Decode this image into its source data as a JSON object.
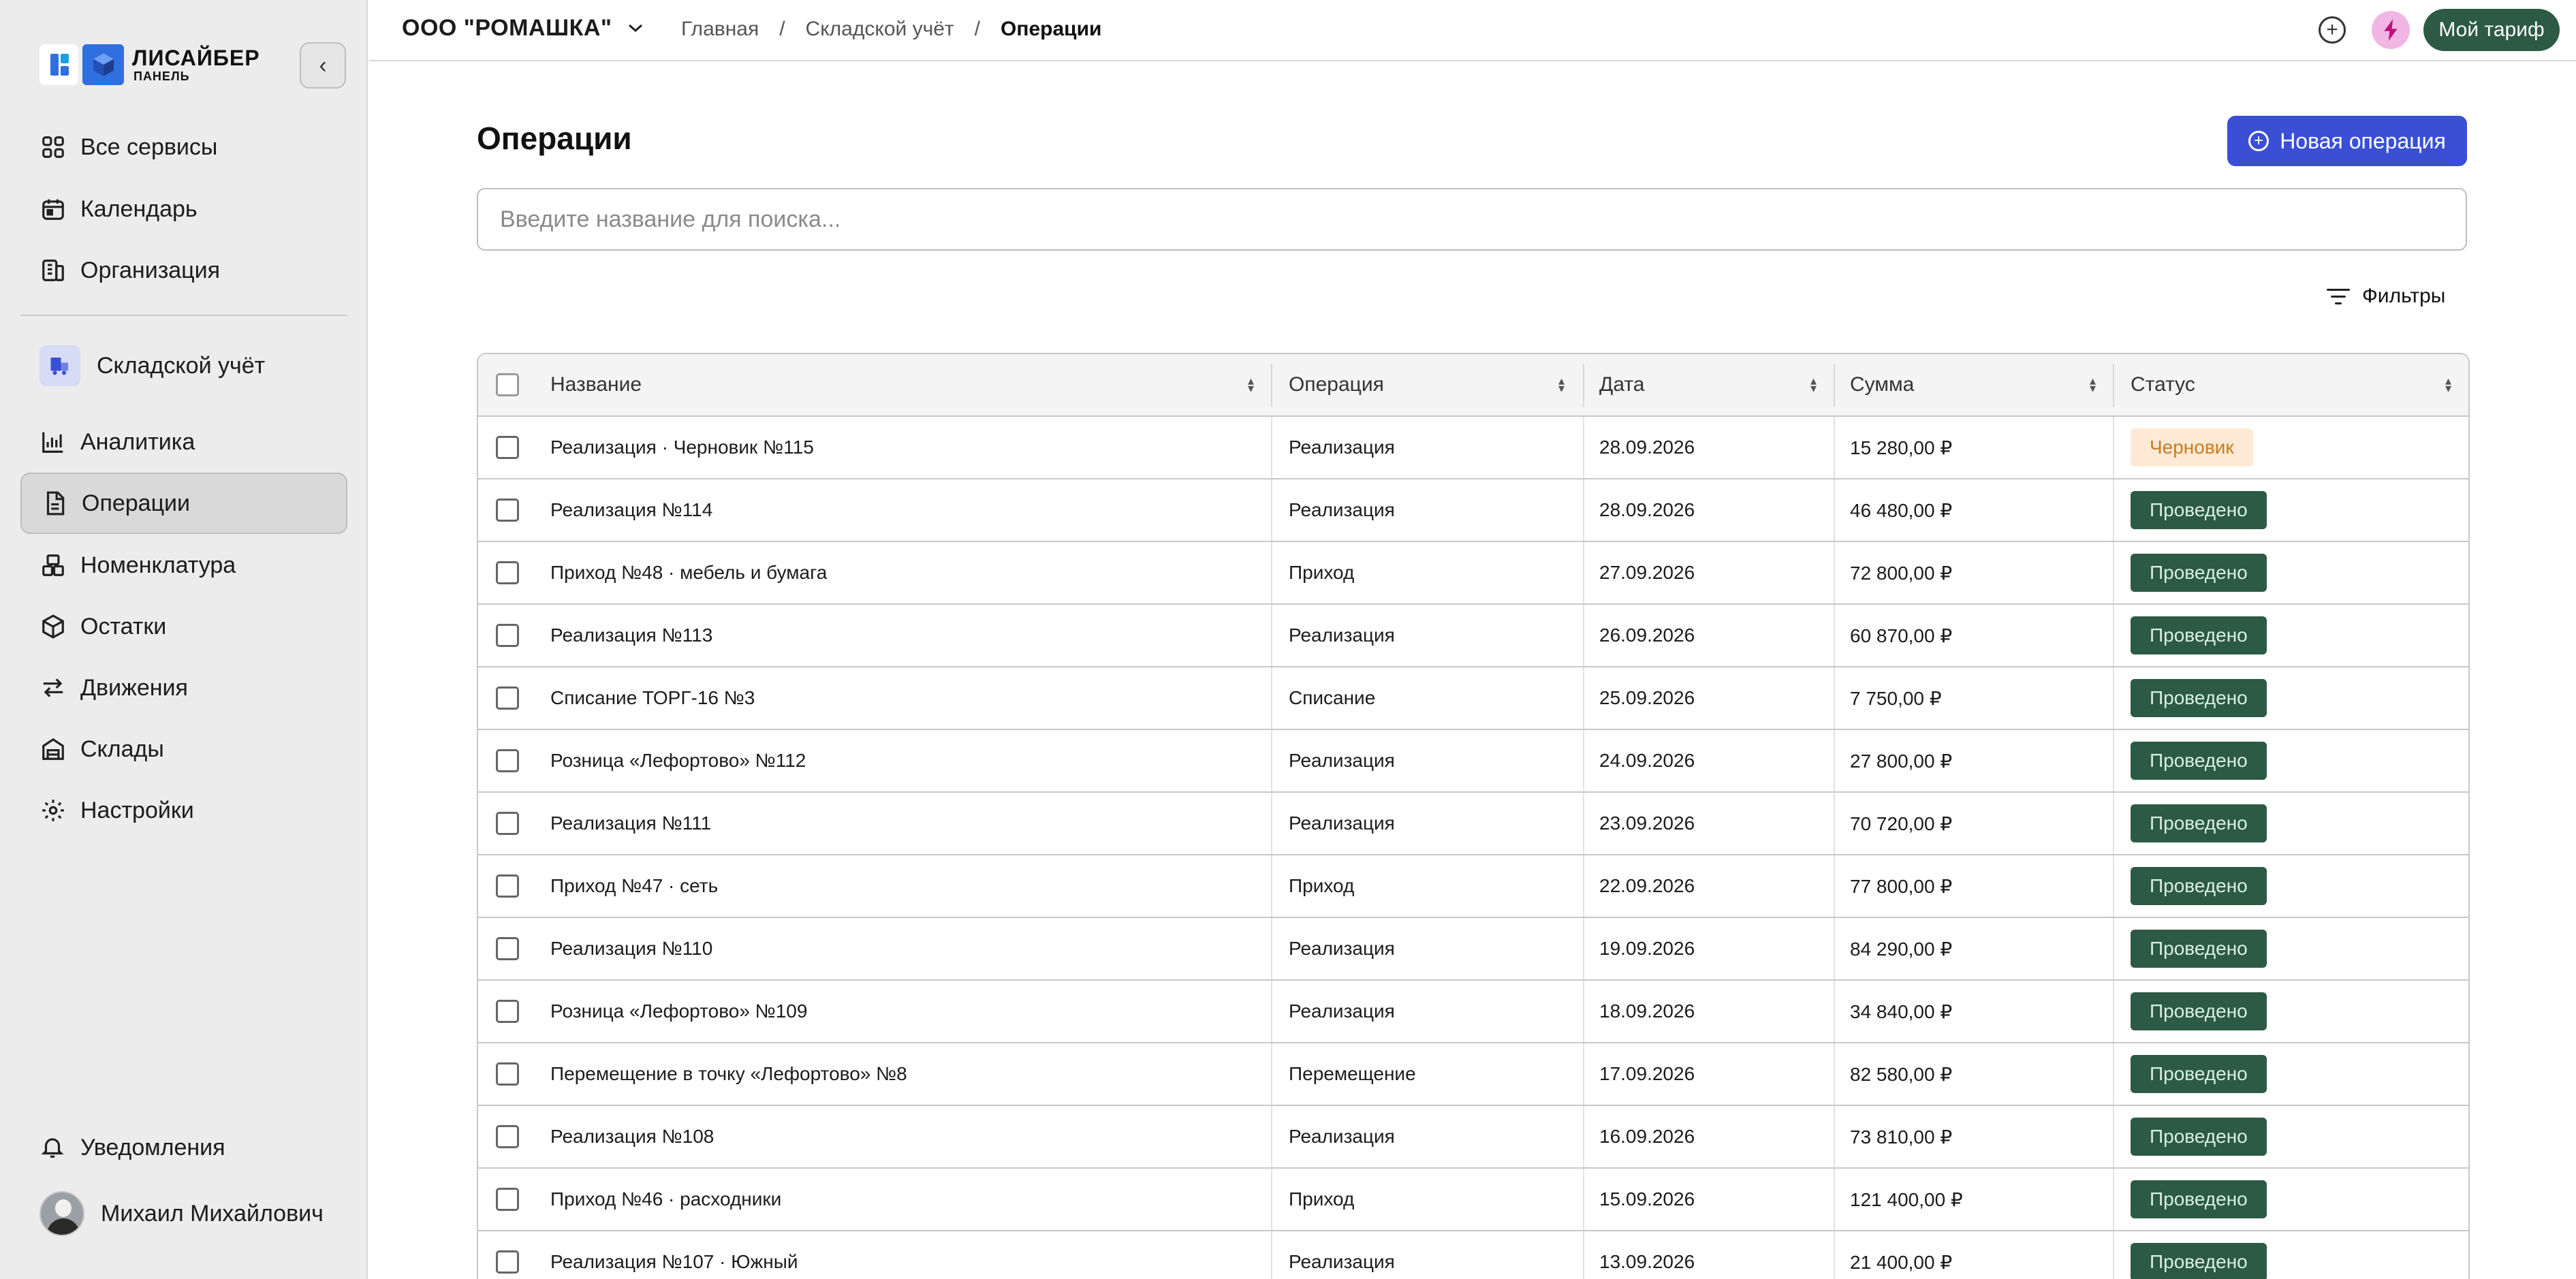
{
  "app": {
    "logo_line1": "ЛИСАЙБЕР",
    "logo_line2": "ПАНЕЛЬ"
  },
  "sidebar": {
    "nav_top": [
      {
        "label": "Все сервисы",
        "icon": "grid-icon"
      },
      {
        "label": "Календарь",
        "icon": "calendar-icon"
      },
      {
        "label": "Организация",
        "icon": "building-icon"
      }
    ],
    "section": {
      "label": "Складской учёт",
      "icon": "warehouse-truck-icon",
      "icon_bg": "#d6dcf5",
      "icon_color": "#3a4fd4"
    },
    "nav_section": [
      {
        "label": "Аналитика",
        "icon": "chart-icon"
      },
      {
        "label": "Операции",
        "icon": "document-icon",
        "active": true
      },
      {
        "label": "Номенклатура",
        "icon": "boxes-icon"
      },
      {
        "label": "Остатки",
        "icon": "cube-icon"
      },
      {
        "label": "Движения",
        "icon": "arrows-icon"
      },
      {
        "label": "Склады",
        "icon": "warehouse-icon"
      },
      {
        "label": "Настройки",
        "icon": "gear-icon"
      }
    ],
    "notifications_label": "Уведомления",
    "user_name": "Михаил Михайлович"
  },
  "topbar": {
    "org_name": "ООО \"РОМАШКА\"",
    "breadcrumbs": [
      "Главная",
      "Складской учёт",
      "Операции"
    ],
    "tariff_label": "Мой тариф",
    "tariff_color": "#2c5a44",
    "bolt_bg": "#f1b6e3"
  },
  "main": {
    "title": "Операции",
    "new_button_label": "Новая операция",
    "new_button_color": "#3a4fd4",
    "search_placeholder": "Введите название для поиска...",
    "filters_label": "Фильтры"
  },
  "table": {
    "columns": [
      "Название",
      "Операция",
      "Дата",
      "Сумма",
      "Статус"
    ],
    "rows": [
      {
        "name": "Реализация · Черновик №115",
        "op": "Реализация",
        "date": "28.09.2026",
        "sum": "15 280,00 ₽",
        "status": "Черновик",
        "status_type": "draft"
      },
      {
        "name": "Реализация №114",
        "op": "Реализация",
        "date": "28.09.2026",
        "sum": "46 480,00 ₽",
        "status": "Проведено",
        "status_type": "done"
      },
      {
        "name": "Приход №48 · мебель и бумага",
        "op": "Приход",
        "date": "27.09.2026",
        "sum": "72 800,00 ₽",
        "status": "Проведено",
        "status_type": "done"
      },
      {
        "name": "Реализация №113",
        "op": "Реализация",
        "date": "26.09.2026",
        "sum": "60 870,00 ₽",
        "status": "Проведено",
        "status_type": "done"
      },
      {
        "name": "Списание ТОРГ-16 №3",
        "op": "Списание",
        "date": "25.09.2026",
        "sum": "7 750,00 ₽",
        "status": "Проведено",
        "status_type": "done"
      },
      {
        "name": "Розница «Лефортово» №112",
        "op": "Реализация",
        "date": "24.09.2026",
        "sum": "27 800,00 ₽",
        "status": "Проведено",
        "status_type": "done"
      },
      {
        "name": "Реализация №111",
        "op": "Реализация",
        "date": "23.09.2026",
        "sum": "70 720,00 ₽",
        "status": "Проведено",
        "status_type": "done"
      },
      {
        "name": "Приход №47 · сеть",
        "op": "Приход",
        "date": "22.09.2026",
        "sum": "77 800,00 ₽",
        "status": "Проведено",
        "status_type": "done"
      },
      {
        "name": "Реализация №110",
        "op": "Реализация",
        "date": "19.09.2026",
        "sum": "84 290,00 ₽",
        "status": "Проведено",
        "status_type": "done"
      },
      {
        "name": "Розница «Лефортово» №109",
        "op": "Реализация",
        "date": "18.09.2026",
        "sum": "34 840,00 ₽",
        "status": "Проведено",
        "status_type": "done"
      },
      {
        "name": "Перемещение в точку «Лефортово» №8",
        "op": "Перемещение",
        "date": "17.09.2026",
        "sum": "82 580,00 ₽",
        "status": "Проведено",
        "status_type": "done"
      },
      {
        "name": "Реализация №108",
        "op": "Реализация",
        "date": "16.09.2026",
        "sum": "73 810,00 ₽",
        "status": "Проведено",
        "status_type": "done"
      },
      {
        "name": "Приход №46 · расходники",
        "op": "Приход",
        "date": "15.09.2026",
        "sum": "121 400,00 ₽",
        "status": "Проведено",
        "status_type": "done"
      },
      {
        "name": "Реализация №107 · Южный",
        "op": "Реализация",
        "date": "13.09.2026",
        "sum": "21 400,00 ₽",
        "status": "Проведено",
        "status_type": "done"
      }
    ]
  }
}
